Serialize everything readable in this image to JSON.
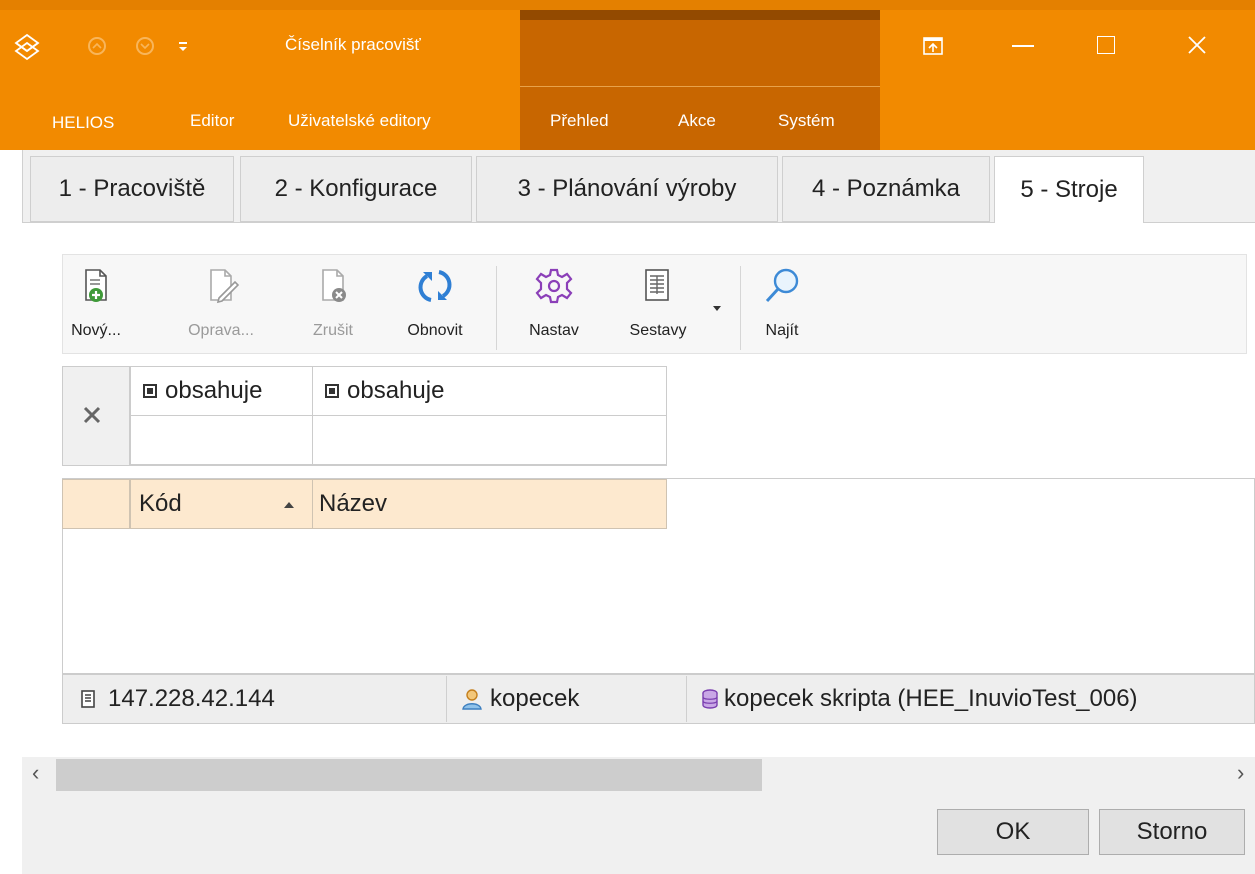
{
  "window": {
    "title": "Číselník pracovišť",
    "accent": "#f28a00",
    "context_color": "#c86600"
  },
  "menu": {
    "items": [
      {
        "label": "HELIOS"
      },
      {
        "label": "Editor"
      },
      {
        "label": "Uživatelské editory"
      },
      {
        "label": "Přehled"
      },
      {
        "label": "Akce"
      },
      {
        "label": "Systém"
      }
    ]
  },
  "tabs": [
    {
      "label": "1 - Pracoviště",
      "active": false
    },
    {
      "label": "2 - Konfigurace",
      "active": false
    },
    {
      "label": "3 - Plánování výroby",
      "active": false
    },
    {
      "label": "4 - Poznámka",
      "active": false
    },
    {
      "label": "5 - Stroje",
      "active": true
    }
  ],
  "toolbar": {
    "buttons": [
      {
        "label": "Nový...",
        "icon": "new-document-icon",
        "enabled": true
      },
      {
        "label": "Oprava...",
        "icon": "edit-document-icon",
        "enabled": false
      },
      {
        "label": "Zrušit",
        "icon": "delete-document-icon",
        "enabled": false
      },
      {
        "label": "Obnovit",
        "icon": "refresh-icon",
        "enabled": true
      },
      {
        "label": "Nastav",
        "icon": "gear-icon",
        "enabled": true
      },
      {
        "label": "Sestavy",
        "icon": "report-icon",
        "enabled": true
      },
      {
        "label": "Najít",
        "icon": "search-icon",
        "enabled": true
      }
    ]
  },
  "filter": {
    "columns": [
      {
        "operator": "obsahuje",
        "value": ""
      },
      {
        "operator": "obsahuje",
        "value": ""
      }
    ]
  },
  "grid": {
    "columns": [
      {
        "label": "Kód",
        "sort": "ascending"
      },
      {
        "label": "Název"
      }
    ],
    "rows": []
  },
  "status": {
    "server": "147.228.42.144",
    "user": "kopecek",
    "database": "kopecek skripta (HEE_InuvioTest_006)"
  },
  "buttons": {
    "ok": "OK",
    "cancel": "Storno"
  }
}
